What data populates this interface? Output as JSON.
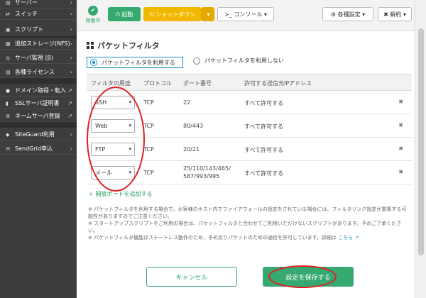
{
  "sidebar": {
    "items": [
      {
        "label": "サーバー",
        "icon": "server-icon",
        "chev": "›"
      },
      {
        "label": "スイッチ",
        "icon": "switch-icon",
        "chev": "›"
      },
      {
        "label": "スクリプト",
        "icon": "script-icon",
        "chev": "›"
      },
      {
        "label": "追加ストレージ(NFS)",
        "icon": "storage-icon",
        "chev": "›"
      },
      {
        "label": "サーバ監視 (β)",
        "icon": "monitor-icon",
        "chev": "›"
      },
      {
        "label": "各種ライセンス",
        "icon": "license-icon",
        "chev": "›"
      },
      {
        "label": "ドメイン取得・転入",
        "icon": "globe-icon",
        "chev": "↗"
      },
      {
        "label": "SSLサーバ証明書",
        "icon": "lock-icon",
        "chev": "↗"
      },
      {
        "label": "ネームサーバ登録",
        "icon": "gear-icon",
        "chev": "↗"
      },
      {
        "label": "SiteGuard利用",
        "icon": "shield-icon",
        "chev": "›"
      },
      {
        "label": "SendGrid申込",
        "icon": "mail-icon",
        "chev": "›"
      }
    ]
  },
  "topbar": {
    "status_label": "稼働中",
    "start_label": "⏻ 起動",
    "shutdown_label": "⏻ シャットダウン",
    "shutdown_caret": "▾",
    "console_label": ">_ コンソール ▾",
    "settings_label": "⚙ 各種設定 ▾",
    "cancel_contract_label": "✖ 解約 ▾"
  },
  "panel": {
    "title": "パケットフィルタ",
    "radio_on": "パケットフィルタを利用する",
    "radio_off": "パケットフィルタを利用しない"
  },
  "table": {
    "headers": [
      "フィルタの用途",
      "プロトコル",
      "ポート番号",
      "許可する送信元IPアドレス"
    ],
    "rows": [
      {
        "purpose": "SSH",
        "protocol": "TCP",
        "port": "22",
        "source": "すべて許可する"
      },
      {
        "purpose": "Web",
        "protocol": "TCP",
        "port": "80/443",
        "source": "すべて許可する"
      },
      {
        "purpose": "FTP",
        "protocol": "TCP",
        "port": "20/21",
        "source": "すべて許可する"
      },
      {
        "purpose": "メール",
        "protocol": "TCP",
        "port_line1": "25/110/143/465/",
        "port_line2": "587/993/995",
        "source": "すべて許可する"
      }
    ],
    "caret": "▾",
    "delete": "✖"
  },
  "add_port": "＋ 開放ポートを追加する",
  "notes": {
    "n1": "※ パケットフィルタを利用する場合で、お客様のホスト内でファイアウォールの設定をされている場合には、フィルタリング設定が重複する可能性がありますのでご注意ください。",
    "n2": "※ スタートアップスクリプトをご利用の場合は、パケットフィルタと合わせてご利用いただけないスクリプトがあります。予めご了承ください。",
    "n3": "※ パケットフィルタ機能はステートレス動作のため、予め戻りパケットのための通信を許可しています。詳細は",
    "link": "こちら"
  },
  "buttons": {
    "cancel": "キャンセル",
    "save": "設定を保存する"
  },
  "colors": {
    "accent": "#36a971",
    "warning": "#f2b800",
    "sidebar_bg": "#3d3d3d",
    "annotation": "#e02020"
  }
}
